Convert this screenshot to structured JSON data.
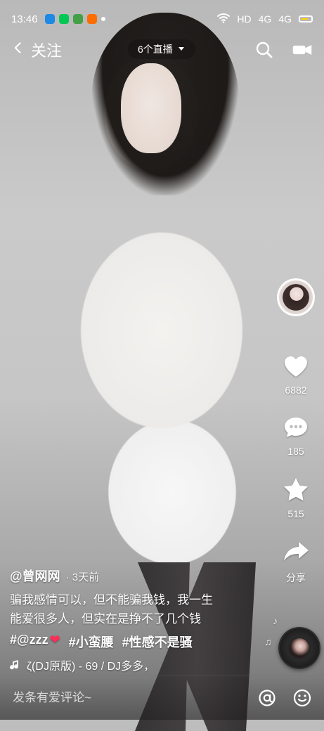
{
  "status_bar": {
    "time": "13:46",
    "network": "HD",
    "signal1": "4G",
    "signal2": "4G"
  },
  "top_nav": {
    "back_label": "关注",
    "live_label": "6个直播"
  },
  "right_rail": {
    "likes": "6882",
    "comments": "185",
    "favorites": "515",
    "share_label": "分享"
  },
  "caption": {
    "author": "@曾网网",
    "time_ago": "· 3天前",
    "text_line1": "骗我感情可以，但不能骗我钱，我一生",
    "text_line2": "能爱很多人，但实在是挣不了几个钱",
    "tag_mention": "#@zzz",
    "tag_heart": "❤",
    "tag2": "#小蛮腰",
    "tag3": "#性感不是骚",
    "music_text": "ζ(DJ原版) - 69 / DJ多多，"
  },
  "comment_bar": {
    "placeholder": "发条有爱评论~"
  },
  "icons": {
    "back": "chevron-left-icon",
    "live_dropdown": "caret-down-icon",
    "search": "search-icon",
    "camera": "video-camera-icon",
    "like": "heart-icon",
    "comment": "comment-bubble-icon",
    "favorite": "star-icon",
    "share": "share-arrow-icon",
    "music": "music-note-icon",
    "mention": "at-icon",
    "emoji": "emoji-icon"
  },
  "colors": {
    "heart_red": "#ff2d55"
  }
}
